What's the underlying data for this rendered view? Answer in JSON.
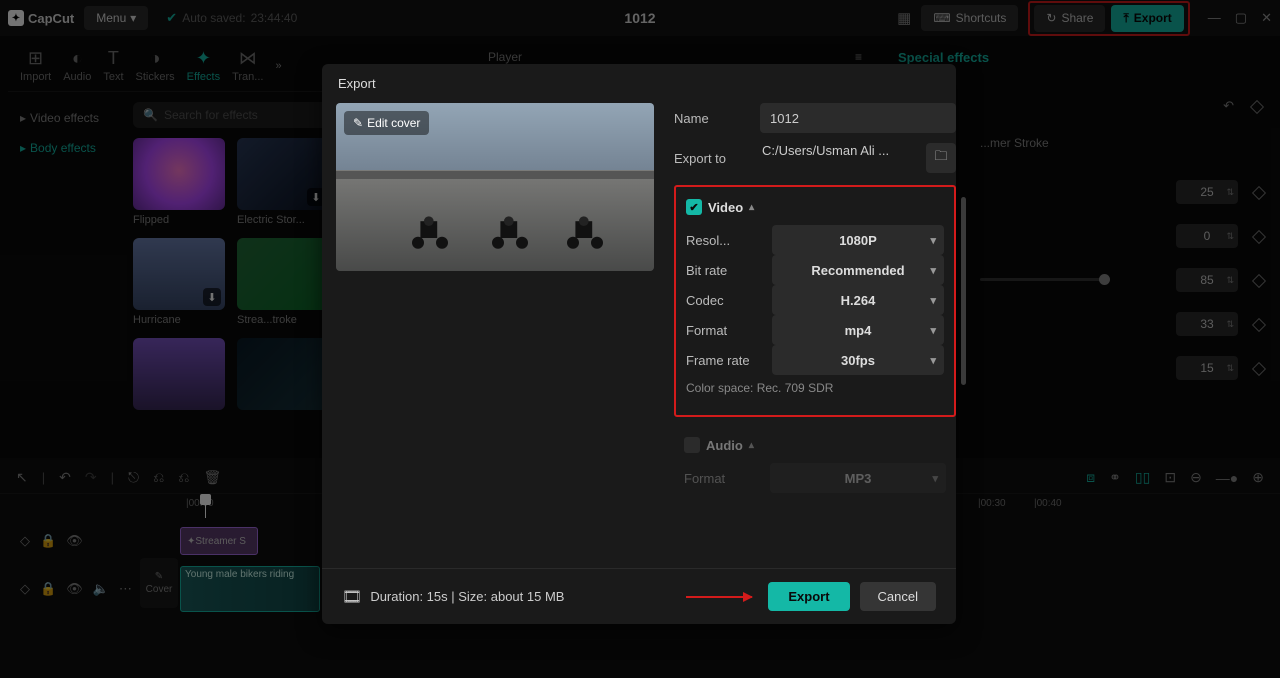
{
  "app": {
    "name": "CapCut",
    "autosave_prefix": "Auto saved:",
    "autosave_time": "23:44:40",
    "project_title": "1012"
  },
  "menu": {
    "label": "Menu"
  },
  "topButtons": {
    "shortcuts": "Shortcuts",
    "share": "Share",
    "export": "Export"
  },
  "tabs": [
    "Import",
    "Audio",
    "Text",
    "Stickers",
    "Effects",
    "Tran..."
  ],
  "sidebar": {
    "video": "Video effects",
    "body": "Body effects"
  },
  "search": {
    "placeholder": "Search for effects"
  },
  "effects": {
    "e0": "Flipped",
    "e1": "Electric Stor...",
    "e2": "Hurricane",
    "e3": "Strea...troke",
    "e4": "",
    "e5": ""
  },
  "playerHeader": "Player",
  "rightPanel": {
    "title": "Special effects",
    "strokeLabel": "...mer Stroke",
    "v0": "25",
    "v1": "0",
    "v2": "85",
    "v3": "33",
    "v4": "15"
  },
  "timeline": {
    "ruler": {
      "t0": "|00:00",
      "t1": "|00:30",
      "t2": "|00:40"
    },
    "coverLabel": "Cover",
    "clips": {
      "effect": "Streamer S",
      "video": "Young male bikers riding"
    }
  },
  "dialog": {
    "title": "Export",
    "editCover": "Edit cover",
    "nameLabel": "Name",
    "nameValue": "1012",
    "exportToLabel": "Export to",
    "exportToPath": "C:/Users/Usman Ali ...",
    "videoHeader": "Video",
    "resolLabel": "Resol...",
    "resolValue": "1080P",
    "bitRateLabel": "Bit rate",
    "bitRateValue": "Recommended",
    "codecLabel": "Codec",
    "codecValue": "H.264",
    "formatLabel": "Format",
    "formatValue": "mp4",
    "frameRateLabel": "Frame rate",
    "frameRateValue": "30fps",
    "colorSpace": "Color space: Rec. 709 SDR",
    "audioHeader": "Audio",
    "audioFormatLabel": "Format",
    "audioFormatValue": "MP3",
    "durationInfo": "Duration: 15s | Size: about 15 MB",
    "exportBtn": "Export",
    "cancelBtn": "Cancel"
  }
}
